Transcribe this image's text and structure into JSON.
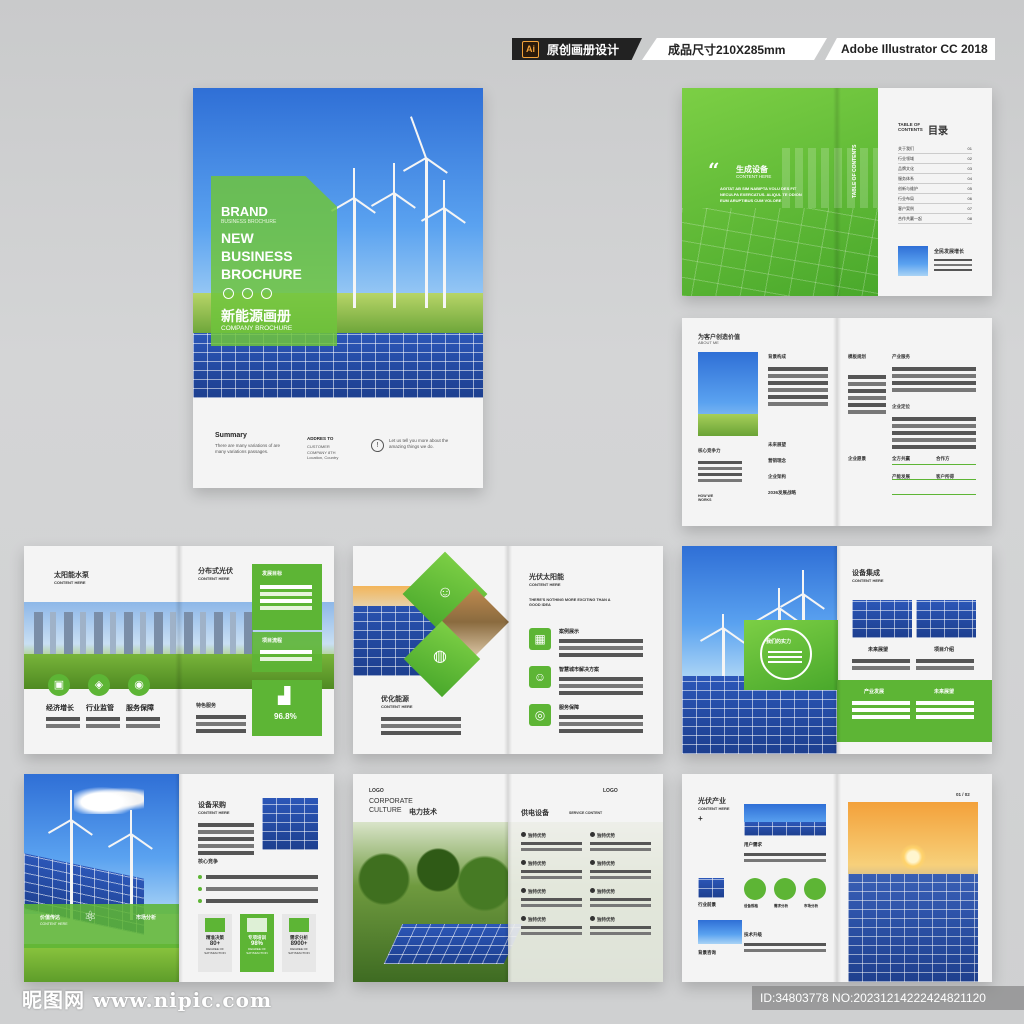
{
  "header": {
    "ai_badge": "Ai",
    "badge1": "原创画册设计",
    "badge2": "成品尺寸210X285mm",
    "badge3": "Adobe Illustrator CC 2018"
  },
  "cover": {
    "brand": "BRAND",
    "brand_sub": "BUSINESS BROCHURE",
    "title_line1": "NEW",
    "title_line2": "BUSINESS",
    "title_line3": "BROCHURE",
    "cn_title": "新能源画册",
    "company": "COMPANY BROCHURE",
    "summary_title": "Summary",
    "summary_text": "There are many variations of are many variations passages.",
    "address_title": "ADDRES TO",
    "address_text": "CUSTOMER COMPANY 8TH Location, Country",
    "info_text": "Let us tell you more about the amazing things we do."
  },
  "toc": {
    "cn_heading": "生成设备",
    "en_heading": "CONTENT HERE",
    "quote": "“",
    "body": "AGITAT AB SIM NABIPTA VOLU DES FIT NECULPA EXERCATUS. ALIQUL TE ODION EUM ARUPTIBUS CUM VOLORE",
    "vertical": "TABLE OF CONTENTS",
    "table_label": "TABLE OF CONTENTS",
    "table_cn": "目录",
    "items": [
      "关于我们",
      "行业领域",
      "品牌文化",
      "服务体系",
      "创新与维护",
      "行业布局",
      "客户案例",
      "合作共赢一起"
    ],
    "numbers": [
      "01",
      "02",
      "03",
      "04",
      "05",
      "06",
      "07",
      "08"
    ],
    "footer_title": "全民发展增长"
  },
  "about": {
    "title": "为客户创造价值",
    "subtitle": "ABOUT ME",
    "col1_title": "背景构成",
    "col1_b": "未来展望",
    "col1_c": "营销理念",
    "col1_d": "企业架构",
    "col1_e": "2036发展战略",
    "left_label": "核心竞争力",
    "we_works": "HOW WE WORKS",
    "right_a": "模板规划",
    "right_b": "产业服务",
    "right_c": "企业定位",
    "right_d": "企业愿景",
    "right_e": "全方共赢",
    "right_f": "合作方",
    "right_g": "产能发展",
    "right_h": "客户所得"
  },
  "pump": {
    "left_title": "太阳能水泵",
    "left_sub": "CONTENT HERE",
    "right_title": "分布式光伏",
    "right_sub": "CONTENT HERE",
    "box1": "发展目标",
    "box2": "项目流程",
    "stat": "96.8%",
    "icon_labels": [
      "经济增长",
      "行业监管",
      "服务保障"
    ],
    "feature": "特色服务"
  },
  "pv": {
    "title": "光伏太阳能",
    "sub": "CONTENT HERE",
    "tagline": "THERE'S NOTHING MORE EXCITING THAN A GOOD IDEA",
    "opt_title": "优化能源",
    "opt_sub": "CONTENT HERE",
    "items": [
      "案例展示",
      "智慧城市解决方案",
      "服务保障"
    ]
  },
  "equip": {
    "title": "设备集成",
    "sub": "CONTENT HERE",
    "circle": "我们的实力",
    "img1": "未来展望",
    "img2": "项目介绍",
    "band1": "产业发展",
    "band2": "未来展望"
  },
  "buy": {
    "title": "设备采购",
    "sub": "CONTENT HERE",
    "core": "核心竞争",
    "left1": "价值传达",
    "left1_sub": "CONTENT HERE",
    "left2": "市场分析",
    "stats": [
      {
        "label": "精准决策",
        "value": "80+",
        "desc": "DEGREE OF SATISFACTION"
      },
      {
        "label": "专项培训",
        "value": "98%",
        "desc": "DEGREE OF SATISFACTION"
      },
      {
        "label": "需求分析",
        "value": "8900+",
        "desc": "DEGREE OF SATISFACTION"
      }
    ]
  },
  "culture": {
    "logo": "LOGO",
    "en1": "CORPORATE",
    "en2": "CULTURE",
    "cn": "电力技术",
    "right_logo": "LOGO",
    "right_title": "供电设备",
    "right_sub": "SERVICE CONTENT",
    "items": [
      "独特优势",
      "独特优势",
      "独特优势",
      "独特优势",
      "独特优势",
      "独特优势",
      "独特优势",
      "独特优势"
    ]
  },
  "industry": {
    "title": "光伏产业",
    "sub": "CONTENT HERE",
    "page": "01 / 02",
    "caption": "光伏产业",
    "labels": [
      "用户需求",
      "行业前景",
      "设备规格",
      "需求分析",
      "市场分析",
      "背景咨询",
      "技术升级"
    ]
  },
  "footer": {
    "watermark": "昵图网 www.nipic.com",
    "id_text": "ID:34803778 NO:20231214222424821120"
  }
}
